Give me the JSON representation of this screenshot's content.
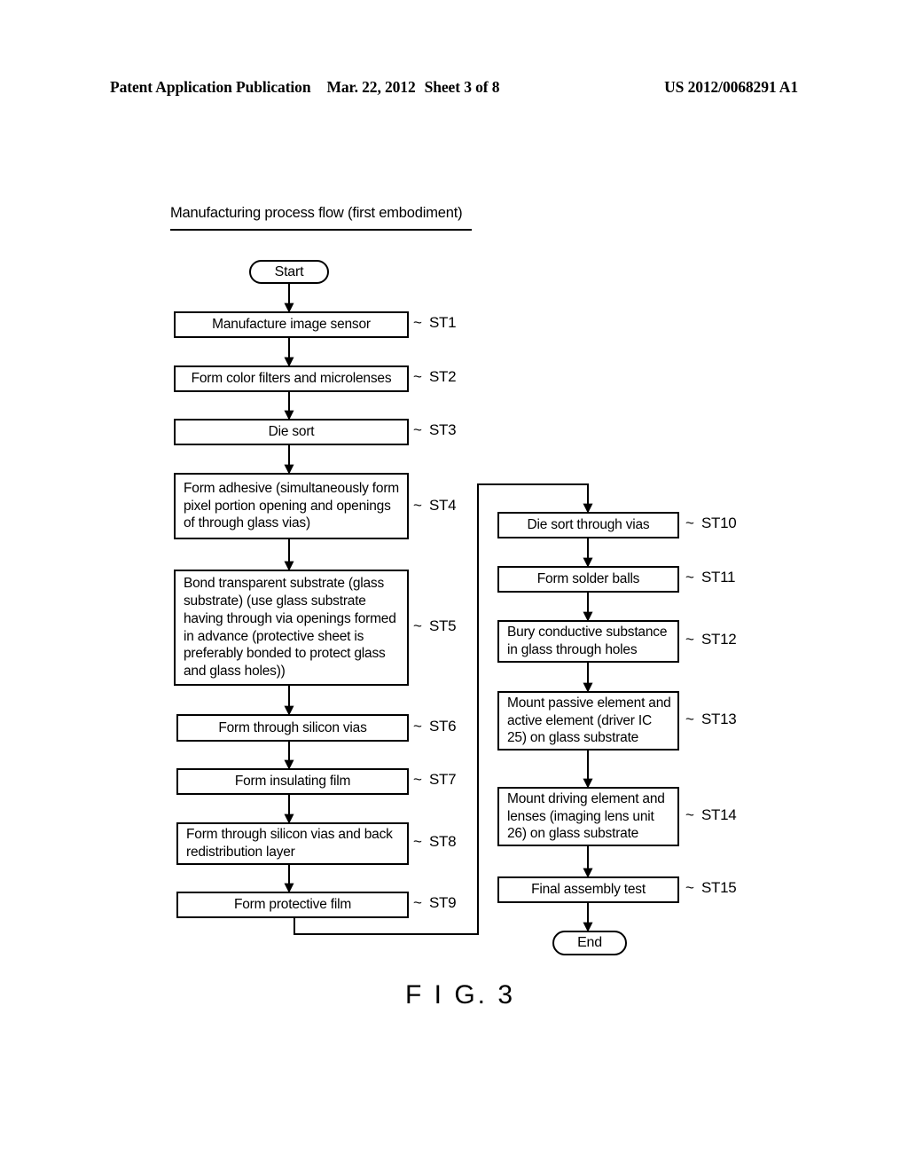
{
  "header": {
    "publication": "Patent Application Publication",
    "date": "Mar. 22, 2012",
    "sheet": "Sheet 3 of 8",
    "doc_number": "US 2012/0068291 A1"
  },
  "figure": {
    "title": "Manufacturing process flow (first embodiment)",
    "caption": "F I G. 3"
  },
  "terminators": {
    "start": "Start",
    "end": "End"
  },
  "steps": [
    {
      "id": "ST1",
      "label": "ST1",
      "text": "Manufacture image sensor"
    },
    {
      "id": "ST2",
      "label": "ST2",
      "text": "Form color filters and microlenses"
    },
    {
      "id": "ST3",
      "label": "ST3",
      "text": "Die sort"
    },
    {
      "id": "ST4",
      "label": "ST4",
      "text": "Form adhesive (simultaneously form pixel portion opening and openings of through glass vias)"
    },
    {
      "id": "ST5",
      "label": "ST5",
      "text": "Bond transparent substrate (glass substrate) (use glass substrate having through via openings formed in advance (protective sheet is preferably bonded to protect glass and glass holes))"
    },
    {
      "id": "ST6",
      "label": "ST6",
      "text": "Form through silicon vias"
    },
    {
      "id": "ST7",
      "label": "ST7",
      "text": "Form insulating film"
    },
    {
      "id": "ST8",
      "label": "ST8",
      "text": "Form through silicon vias and back redistribution layer"
    },
    {
      "id": "ST9",
      "label": "ST9",
      "text": "Form protective film"
    },
    {
      "id": "ST10",
      "label": "ST10",
      "text": "Die sort through vias"
    },
    {
      "id": "ST11",
      "label": "ST11",
      "text": "Form solder balls"
    },
    {
      "id": "ST12",
      "label": "ST12",
      "text": "Bury conductive substance in glass through holes"
    },
    {
      "id": "ST13",
      "label": "ST13",
      "text": "Mount passive element and active element (driver IC 25) on glass substrate"
    },
    {
      "id": "ST14",
      "label": "ST14",
      "text": "Mount driving element and lenses (imaging lens unit 26) on glass substrate"
    },
    {
      "id": "ST15",
      "label": "ST15",
      "text": "Final assembly test"
    }
  ],
  "connector_symbol": "~"
}
